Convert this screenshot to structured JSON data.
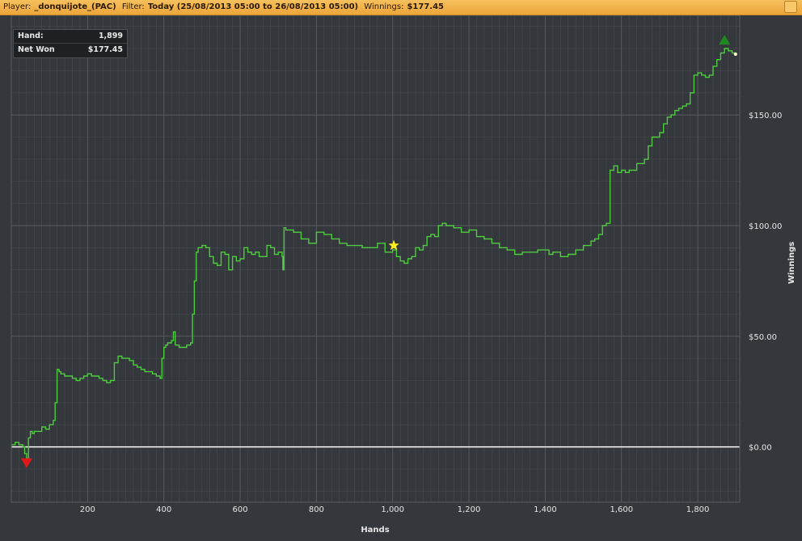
{
  "titlebar": {
    "player_label": "Player:",
    "player_value": "_donquijote_(PAC)",
    "filter_label": "Filter:",
    "filter_value": "Today (25/08/2013 05:00 to 26/08/2013 05:00)",
    "winnings_label": "Winnings:",
    "winnings_value": "$177.45"
  },
  "info": {
    "hand_label": "Hand:",
    "hand_value": "1,899",
    "netwon_label": "Net Won",
    "netwon_value": "$177.45"
  },
  "colors": {
    "background": "#34383c",
    "grid_major": "#565b60",
    "grid_minor": "#44494e",
    "line": "#4ecb3e",
    "zero_line": "#ffffff",
    "max_marker": "#1f8a1f",
    "min_marker": "#e01818",
    "star_marker": "#ffee22"
  },
  "chart_data": {
    "type": "line",
    "xlabel": "Hands",
    "ylabel": "Winnings",
    "xlim": [
      0,
      1910
    ],
    "ylim": [
      -25,
      195
    ],
    "x_ticks": [
      200,
      400,
      600,
      800,
      1000,
      1200,
      1400,
      1600,
      1800
    ],
    "x_tick_labels": [
      "200",
      "400",
      "600",
      "800",
      "1,000",
      "1,200",
      "1,400",
      "1,600",
      "1,800"
    ],
    "y_ticks": [
      0,
      50,
      100,
      150
    ],
    "y_tick_labels": [
      "$0.00",
      "$50.00",
      "$100.00",
      "$150.00"
    ],
    "grid": true,
    "markers": {
      "max": {
        "x": 1870,
        "y": 184
      },
      "min": {
        "x": 40,
        "y": -7
      },
      "star": {
        "x": 1003,
        "y": 91
      },
      "end": {
        "x": 1899,
        "y": 177.45
      }
    },
    "series": [
      {
        "x": [
          0,
          10,
          20,
          25,
          30,
          35,
          40,
          45,
          50,
          55,
          60,
          70,
          80,
          90,
          100,
          110,
          115,
          120,
          125,
          130,
          140,
          150,
          160,
          170,
          180,
          190,
          200,
          210,
          220,
          230,
          240,
          250,
          260,
          270,
          280,
          290,
          300,
          310,
          320,
          330,
          340,
          350,
          360,
          370,
          380,
          390,
          395,
          400,
          405,
          410,
          420,
          425,
          430,
          440,
          450,
          460,
          470,
          475,
          480,
          485,
          490,
          500,
          510,
          520,
          530,
          540,
          550,
          560,
          570,
          580,
          590,
          600,
          610,
          620,
          630,
          640,
          650,
          660,
          670,
          680,
          690,
          700,
          710,
          712,
          715,
          720,
          740,
          760,
          780,
          800,
          820,
          840,
          860,
          880,
          900,
          920,
          940,
          960,
          980,
          990,
          1000,
          1010,
          1020,
          1030,
          1040,
          1050,
          1060,
          1070,
          1080,
          1090,
          1100,
          1110,
          1120,
          1130,
          1140,
          1160,
          1180,
          1200,
          1220,
          1240,
          1260,
          1280,
          1300,
          1320,
          1340,
          1360,
          1380,
          1400,
          1410,
          1420,
          1440,
          1460,
          1480,
          1500,
          1520,
          1530,
          1540,
          1550,
          1560,
          1570,
          1580,
          1590,
          1600,
          1610,
          1620,
          1640,
          1660,
          1670,
          1680,
          1700,
          1710,
          1720,
          1730,
          1740,
          1750,
          1760,
          1770,
          1780,
          1790,
          1800,
          1810,
          1820,
          1830,
          1840,
          1850,
          1860,
          1870,
          1880,
          1890,
          1899
        ],
        "y": [
          1,
          2,
          1,
          1,
          0,
          -3,
          -7,
          4,
          7,
          6,
          7,
          7,
          9,
          8,
          10,
          12,
          20,
          35,
          34,
          33,
          32,
          32,
          31,
          30,
          31,
          32,
          33,
          32,
          32,
          31,
          30,
          29,
          30,
          38,
          41,
          40,
          40,
          39,
          37,
          36,
          35,
          34,
          34,
          33,
          32,
          31,
          40,
          45,
          46,
          47,
          48,
          52,
          46,
          45,
          45,
          46,
          47,
          60,
          75,
          88,
          90,
          91,
          90,
          86,
          83,
          82,
          88,
          87,
          80,
          86,
          84,
          85,
          90,
          88,
          87,
          88,
          86,
          86,
          91,
          90,
          87,
          88,
          86,
          80,
          99,
          98,
          97,
          94,
          92,
          97,
          96,
          94,
          92,
          91,
          91,
          90,
          90,
          92,
          88,
          88,
          89,
          86,
          84,
          83,
          85,
          86,
          90,
          89,
          91,
          95,
          96,
          95,
          100,
          101,
          100,
          99,
          97,
          98,
          95,
          94,
          92,
          90,
          89,
          87,
          88,
          88,
          89,
          89,
          87,
          88,
          86,
          87,
          89,
          91,
          93,
          94,
          96,
          100,
          101,
          125,
          127,
          124,
          125,
          124,
          125,
          128,
          130,
          136,
          140,
          142,
          146,
          149,
          150,
          152,
          153,
          154,
          155,
          160,
          168,
          169,
          168,
          167,
          168,
          172,
          175,
          178,
          180,
          179,
          178,
          177.45
        ]
      }
    ]
  }
}
